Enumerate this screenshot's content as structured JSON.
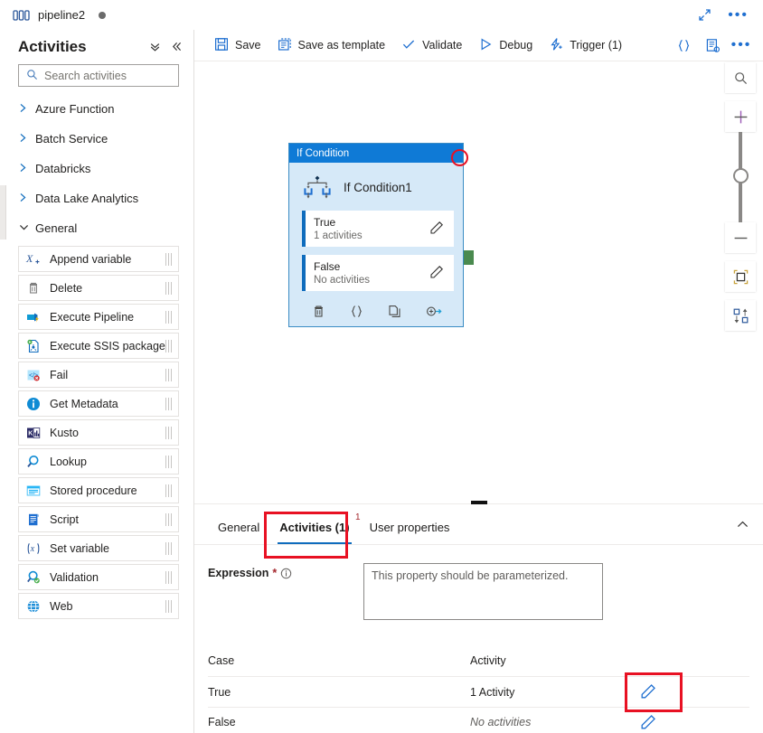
{
  "titlebar": {
    "pipeline_name": "pipeline2",
    "pipeline_icon": "pipeline-icon",
    "unsaved_indicator": "unsaved-changes-dot",
    "expand_icon": "expand-diagonal-icon",
    "more_icon": "more-ellipsis-icon"
  },
  "sidebar": {
    "title": "Activities",
    "collapse_all_icon": "double-chevron-down-icon",
    "collapse_panel_icon": "double-chevron-left-icon",
    "search": {
      "placeholder": "Search activities",
      "value": ""
    },
    "categories": [
      {
        "label": "Azure Function",
        "expanded": false
      },
      {
        "label": "Batch Service",
        "expanded": false
      },
      {
        "label": "Databricks",
        "expanded": false
      },
      {
        "label": "Data Lake Analytics",
        "expanded": false
      },
      {
        "label": "General",
        "expanded": true
      }
    ],
    "general_activities": [
      {
        "label": "Append variable",
        "icon": "append-variable-icon"
      },
      {
        "label": "Delete",
        "icon": "delete-trash-icon"
      },
      {
        "label": "Execute Pipeline",
        "icon": "execute-pipeline-icon"
      },
      {
        "label": "Execute SSIS package",
        "icon": "execute-ssis-package-icon"
      },
      {
        "label": "Fail",
        "icon": "fail-icon"
      },
      {
        "label": "Get Metadata",
        "icon": "get-metadata-info-icon"
      },
      {
        "label": "Kusto",
        "icon": "kusto-icon"
      },
      {
        "label": "Lookup",
        "icon": "lookup-magnifier-icon"
      },
      {
        "label": "Stored procedure",
        "icon": "stored-procedure-icon"
      },
      {
        "label": "Script",
        "icon": "script-icon"
      },
      {
        "label": "Set variable",
        "icon": "set-variable-icon"
      },
      {
        "label": "Validation",
        "icon": "validation-icon"
      },
      {
        "label": "Web",
        "icon": "web-globe-icon"
      }
    ]
  },
  "toolbar": {
    "save_label": "Save",
    "save_as_template_label": "Save as template",
    "validate_label": "Validate",
    "debug_label": "Debug",
    "trigger_label": "Trigger (1)",
    "code_icon": "code-braces-icon",
    "properties_icon": "pipeline-properties-icon",
    "more_icon": "more-ellipsis-icon"
  },
  "canvas": {
    "node": {
      "header": "If Condition",
      "name": "If Condition1",
      "activity_icon": "if-condition-icon",
      "branches": [
        {
          "name": "True",
          "subtitle": "1 activities",
          "edit_icon": "pencil-edit-icon"
        },
        {
          "name": "False",
          "subtitle": "No activities",
          "edit_icon": "pencil-edit-icon"
        }
      ],
      "actions": [
        {
          "icon": "delete-trash-icon"
        },
        {
          "icon": "code-braces-icon"
        },
        {
          "icon": "copy-icon"
        },
        {
          "icon": "add-output-icon"
        }
      ],
      "output_connector": "output-connector-handle",
      "annotation": "red-circle-annotation"
    },
    "controls": [
      {
        "icon": "zoom-to-fit-search-icon"
      },
      {
        "icon": "zoom-in-plus-icon"
      },
      {
        "icon": "zoom-out-minus-icon"
      },
      {
        "icon": "fit-to-screen-icon"
      },
      {
        "icon": "auto-align-icon"
      }
    ]
  },
  "properties": {
    "drag_handle": "panel-drag-handle",
    "tabs": [
      {
        "label": "General",
        "active": false,
        "superscript": ""
      },
      {
        "label": "Activities (1)",
        "active": true,
        "superscript": "1"
      },
      {
        "label": "User properties",
        "active": false,
        "superscript": ""
      }
    ],
    "collapse_icon": "chevron-up-icon",
    "expression": {
      "label": "Expression",
      "required_mark": "*",
      "info_icon": "info-circle-icon",
      "placeholder": "This property should be parameterized.",
      "value": ""
    },
    "table": {
      "columns": [
        "Case",
        "Activity"
      ],
      "rows": [
        {
          "case": "True",
          "activity": "1 Activity",
          "activity_muted": false,
          "edit_icon": "pencil-edit-icon",
          "annotated": true
        },
        {
          "case": "False",
          "activity": "No activities",
          "activity_muted": true,
          "edit_icon": "pencil-edit-icon",
          "annotated": false
        }
      ]
    }
  },
  "colors": {
    "accent_blue": "#0f6cbd",
    "node_header_blue": "#0f7ad6",
    "node_body_blue": "#d6e9f8",
    "annotation_red": "#e81123",
    "connector_green": "#4a8a4f",
    "required_red": "#a4262c"
  }
}
